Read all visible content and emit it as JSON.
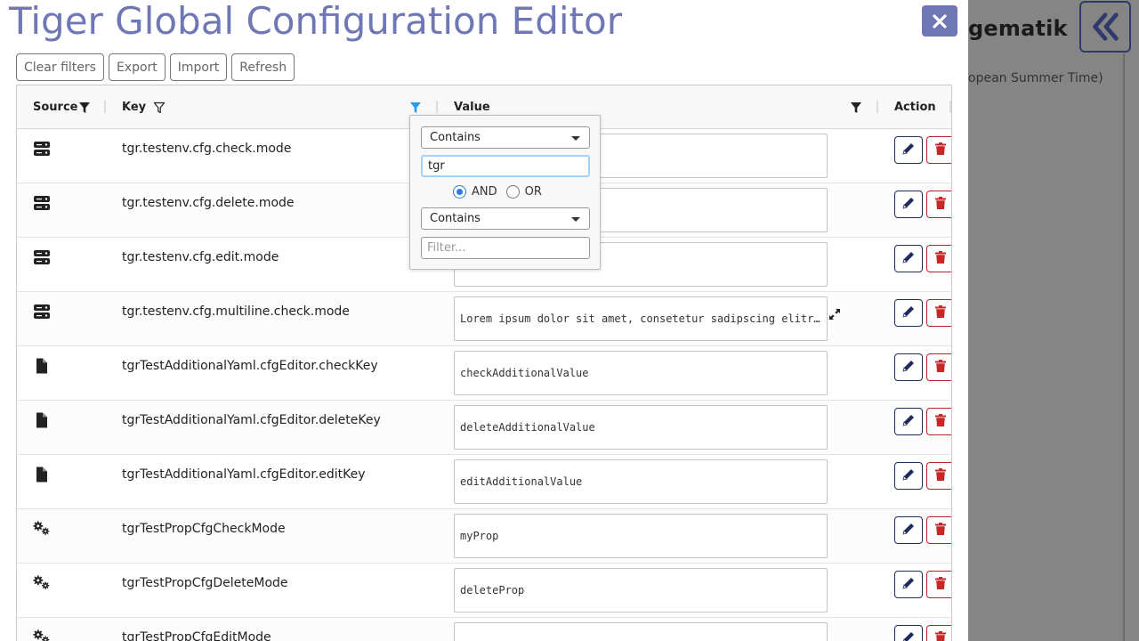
{
  "background": {
    "logo_text": "gematik",
    "time_text": "opean Summer Time)"
  },
  "modal": {
    "title": "Tiger Global Configuration Editor"
  },
  "toolbar": {
    "clear_filters": "Clear filters",
    "export": "Export",
    "import": "Import",
    "refresh": "Refresh"
  },
  "columns": {
    "source": "Source",
    "key": "Key",
    "value": "Value",
    "action": "Action"
  },
  "filter_popup": {
    "condition1": "Contains",
    "value1": "tgr",
    "operator_and": "AND",
    "operator_or": "OR",
    "selected_operator": "AND",
    "condition2": "Contains",
    "value2_placeholder": "Filter..."
  },
  "rows": [
    {
      "source_icon": "server-icon",
      "key": "tgr.testenv.cfg.check.mode",
      "value": ""
    },
    {
      "source_icon": "server-icon",
      "key": "tgr.testenv.cfg.delete.mode",
      "value": ""
    },
    {
      "source_icon": "server-icon",
      "key": "tgr.testenv.cfg.edit.mode",
      "value": ""
    },
    {
      "source_icon": "server-icon",
      "key": "tgr.testenv.cfg.multiline.check.mode",
      "value": "Lorem ipsum dolor sit amet, consetetur sadipscing elitr, sed diam nonumy"
    },
    {
      "source_icon": "file-icon",
      "key": "tgrTestAdditionalYaml.cfgEditor.checkKey",
      "value": "checkAdditionalValue"
    },
    {
      "source_icon": "file-icon",
      "key": "tgrTestAdditionalYaml.cfgEditor.deleteKey",
      "value": "deleteAdditionalValue"
    },
    {
      "source_icon": "file-icon",
      "key": "tgrTestAdditionalYaml.cfgEditor.editKey",
      "value": "editAdditionalValue"
    },
    {
      "source_icon": "gears-icon",
      "key": "tgrTestPropCfgCheckMode",
      "value": "myProp"
    },
    {
      "source_icon": "gears-icon",
      "key": "tgrTestPropCfgDeleteMode",
      "value": "deleteProp"
    },
    {
      "source_icon": "gears-icon",
      "key": "tgrTestPropCfgEditMode",
      "value": ""
    }
  ]
}
